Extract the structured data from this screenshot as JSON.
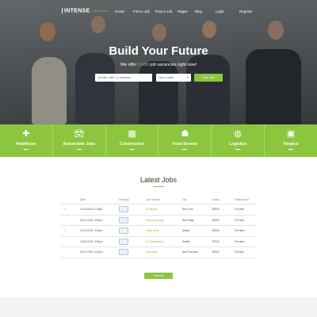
{
  "nav": {
    "logo": "INTENSE",
    "logo_sub": "Job Board",
    "items": [
      "Home",
      "Find a Job",
      "Post a Job",
      "Pages",
      "Blog"
    ],
    "login": "Login",
    "register": "Register"
  },
  "hero": {
    "title": "Build Your Future",
    "sub_before": "We offer",
    "sub_count": "2,489",
    "sub_after": "job vacancies right now!",
    "keyword_placeholder": "Job title, skills, or company",
    "location_placeholder": "City or state",
    "find_button": "Find Job"
  },
  "categories": [
    {
      "label": "Healthcare",
      "icon": "medical-cross-icon"
    },
    {
      "label": "Automobile Jobs",
      "icon": "car-icon"
    },
    {
      "label": "Construction",
      "icon": "building-icon"
    },
    {
      "label": "Food Service",
      "icon": "food-tray-icon"
    },
    {
      "label": "Logistics",
      "icon": "globe-icon"
    },
    {
      "label": "Finance",
      "icon": "money-icon"
    }
  ],
  "jobs": {
    "title": "Latest Jobs",
    "columns": [
      "Date",
      "Company",
      "Job Vacancy",
      "City",
      "Salary",
      "Employment"
    ],
    "rows": [
      {
        "date": "11.05.2016, 4:16pm",
        "title": "Developer",
        "city": "New York",
        "salary": "$3000",
        "type": "Full time",
        "mark": "star-red"
      },
      {
        "date": "08.02.2016, 3:39pm",
        "title": "Project Manager",
        "city": "San Diego",
        "salary": "$4000",
        "type": "Full time",
        "mark": ""
      },
      {
        "date": "14.01.2016, 3:42pm",
        "title": "Trade Artist",
        "city": "Dallas",
        "salary": "$2000",
        "type": "Part time",
        "mark": "star-green"
      },
      {
        "date": "13.08.2016, 3:45pm",
        "title": "UI Programmer",
        "city": "Seattle",
        "salary": "$7000",
        "type": "Part time",
        "mark": ""
      },
      {
        "date": "16.01.2016, 4:42pm",
        "title": "Developer",
        "city": "San Francisco",
        "salary": "$3000",
        "type": "Full time",
        "mark": ""
      }
    ],
    "view_all": "View All"
  },
  "colors": {
    "accent": "#8cc63f",
    "star_red": "#e53935"
  }
}
